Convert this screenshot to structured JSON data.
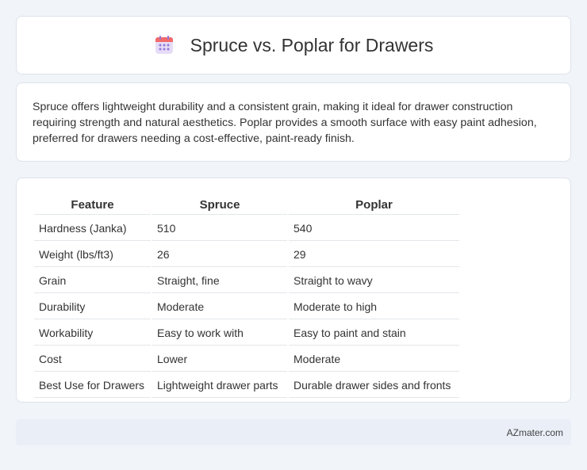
{
  "header": {
    "title": "Spruce vs. Poplar for Drawers",
    "icon": "calendar-icon",
    "icon_colors": {
      "top": "#f26a6a",
      "body": "#e6dcf7",
      "dots": "#8f7ad6"
    }
  },
  "summary": {
    "text": "Spruce offers lightweight durability and a consistent grain, making it ideal for drawer construction requiring strength and natural aesthetics. Poplar provides a smooth surface with easy paint adhesion, preferred for drawers needing a cost-effective, paint-ready finish."
  },
  "table": {
    "headers": [
      "Feature",
      "Spruce",
      "Poplar"
    ],
    "rows": [
      [
        "Hardness (Janka)",
        "510",
        "540"
      ],
      [
        "Weight (lbs/ft3)",
        "26",
        "29"
      ],
      [
        "Grain",
        "Straight, fine",
        "Straight to wavy"
      ],
      [
        "Durability",
        "Moderate",
        "Moderate to high"
      ],
      [
        "Workability",
        "Easy to work with",
        "Easy to paint and stain"
      ],
      [
        "Cost",
        "Lower",
        "Moderate"
      ],
      [
        "Best Use for Drawers",
        "Lightweight drawer parts",
        "Durable drawer sides and fronts"
      ]
    ]
  },
  "footer": {
    "brand": "AZmater.com"
  }
}
